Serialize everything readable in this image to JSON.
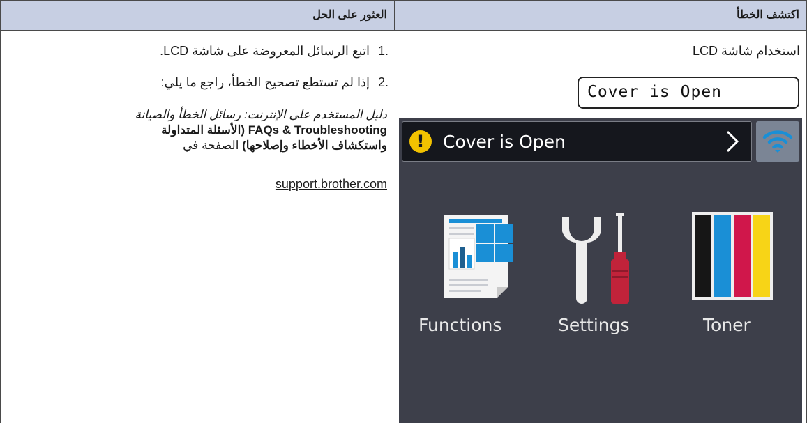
{
  "header": {
    "solution_title": "العثور على الحل",
    "error_title": "اكتشف الخطأ"
  },
  "steps": [
    {
      "num": ".1",
      "text": "اتبع الرسائل المعروضة على شاشة LCD."
    },
    {
      "num": ".2",
      "text": "إذا لم تستطع تصحيح الخطأ، راجع ما يلي:"
    }
  ],
  "reference": {
    "line1": "دليل المستخدم على الإنترنت: رسائل الخطأ والصيانة",
    "line2": "FAQs & Troubleshooting (الأسئلة المتداولة",
    "line3_bold": "واستكشاف الأخطاء وإصلاحها)",
    "line3_rest": " الصفحة في",
    "link": "support.brother.com"
  },
  "lcd": {
    "label": "استخدام شاشة LCD",
    "message": "Cover is Open",
    "status_text": "Cover is Open",
    "warn_symbol": "!",
    "items": [
      {
        "label": "Functions",
        "icon": "functions-icon"
      },
      {
        "label": "Settings",
        "icon": "settings-icon"
      },
      {
        "label": "Toner",
        "icon": "toner-icon"
      }
    ]
  },
  "colors": {
    "header_bg": "#c7cfe3",
    "screen_bg": "#3d3f4a",
    "warning": "#f2c200",
    "accent_blue": "#1a8fd6"
  }
}
